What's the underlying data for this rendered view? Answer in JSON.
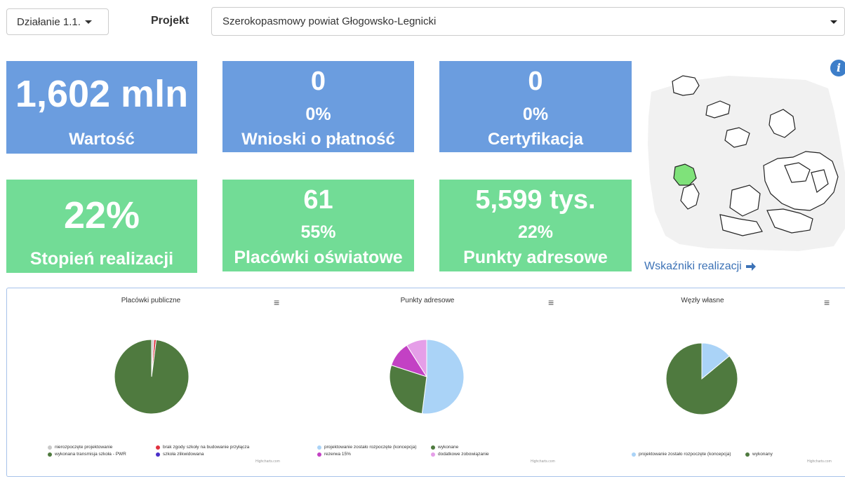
{
  "header": {
    "action_dropdown": "Działanie 1.1.",
    "project_label": "Projekt",
    "project_select": "Szerokopasmowy powiat Głogowsko-Legnicki"
  },
  "tiles": {
    "wartosc": {
      "value": "1,602 mln",
      "label": "Wartość"
    },
    "wnioski": {
      "value": "0",
      "percent": "0%",
      "label": "Wnioski o płatność"
    },
    "certyfikacja": {
      "value": "0",
      "percent": "0%",
      "label": "Certyfikacja"
    },
    "stopien": {
      "value": "22%",
      "label": "Stopień realizacji"
    },
    "placowki": {
      "value": "61",
      "percent": "55%",
      "label": "Placówki oświatowe"
    },
    "punkty": {
      "value": "5,599 tys.",
      "percent": "22%",
      "label": "Punkty adresowe"
    }
  },
  "map": {
    "info_icon": "i",
    "link_text": "Wskaźniki realizacji",
    "link_icon": "arrow-right-icon",
    "highlight_color": "#7fe27a"
  },
  "charts": [
    {
      "title": "Placówki publiczne",
      "menu_icon": "≡",
      "credit": "Highcharts.com",
      "legend": [
        {
          "label": "nierozpoczęte projektowanie",
          "color": "#c9c9c9"
        },
        {
          "label": "brak zgody szkoły na budowanie przyłącza",
          "color": "#e0313f"
        },
        {
          "label": "wykonana transmisja szkoła - PWR",
          "color": "#4f7a3f"
        },
        {
          "label": "szkoła zlikwidowana",
          "color": "#4a2fc9"
        }
      ]
    },
    {
      "title": "Punkty adresowe",
      "menu_icon": "≡",
      "credit": "Highcharts.com",
      "legend": [
        {
          "label": "projektowanie zostało rozpoczęte (koncepcja)",
          "color": "#aad3f7"
        },
        {
          "label": "wykonane",
          "color": "#4f7a3f"
        },
        {
          "label": "rezerwa 15%",
          "color": "#c341c4"
        },
        {
          "label": "dodatkowe zobowiązanie",
          "color": "#e59ee8"
        }
      ]
    },
    {
      "title": "Węzły własne",
      "menu_icon": "≡",
      "credit": "Highcharts.com",
      "legend": [
        {
          "label": "projektowanie zostało rozpoczęte (koncepcja)",
          "color": "#aad3f7"
        },
        {
          "label": "wykonany",
          "color": "#4f7a3f"
        }
      ]
    }
  ],
  "chart_data": [
    {
      "type": "pie",
      "title": "Placówki publiczne",
      "series": [
        {
          "values": [
            {
              "label": "nierozpoczęte projektowanie",
              "value": 1.0
            },
            {
              "label": "brak zgody szkoły na budowanie przyłącza",
              "value": 1.0
            },
            {
              "label": "wykonana transmisja szkoła - PWR",
              "value": 98.0
            },
            {
              "label": "szkoła zlikwidowana",
              "value": 0
            }
          ]
        }
      ]
    },
    {
      "type": "pie",
      "title": "Punkty adresowe",
      "series": [
        {
          "values": [
            {
              "label": "projektowanie zostało rozpoczęte (koncepcja)",
              "value": 52.0
            },
            {
              "label": "wykonane",
              "value": 28.0
            },
            {
              "label": "rezerwa 15%",
              "value": 11.0
            },
            {
              "label": "dodatkowe zobowiązanie",
              "value": 9.0
            }
          ]
        }
      ]
    },
    {
      "type": "pie",
      "title": "Węzły własne",
      "series": [
        {
          "values": [
            {
              "label": "projektowanie zostało rozpoczęte (koncepcja)",
              "value": 14.0
            },
            {
              "label": "wykonany",
              "value": 86.0
            }
          ]
        }
      ]
    }
  ]
}
